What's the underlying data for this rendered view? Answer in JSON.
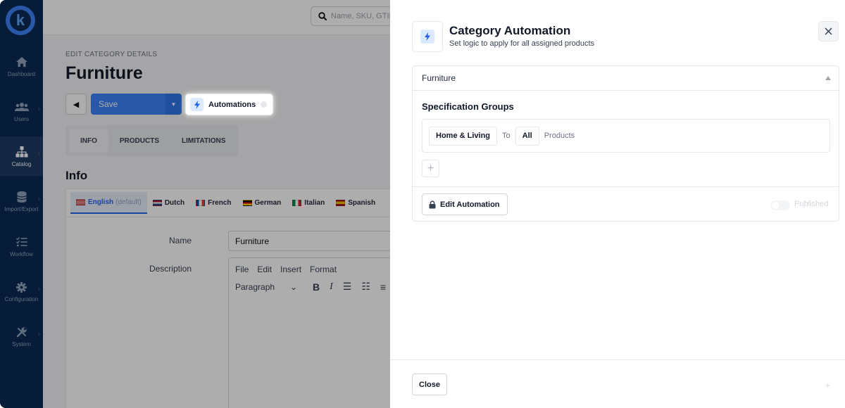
{
  "sidebar": {
    "logo_letter": "k",
    "items": [
      {
        "label": "Dashboard",
        "icon": "home-icon",
        "has_chevron": false
      },
      {
        "label": "Users",
        "icon": "users-icon",
        "has_chevron": true
      },
      {
        "label": "Catalog",
        "icon": "sitemap-icon",
        "has_chevron": true
      },
      {
        "label": "Import/Export",
        "icon": "database-icon",
        "has_chevron": true
      },
      {
        "label": "Workflow",
        "icon": "tasks-icon",
        "has_chevron": false
      },
      {
        "label": "Configuration",
        "icon": "gear-icon",
        "has_chevron": true
      },
      {
        "label": "System",
        "icon": "tools-icon",
        "has_chevron": true
      }
    ]
  },
  "topbar": {
    "search_placeholder": "Name, SKU, GTIN"
  },
  "page": {
    "eyebrow": "EDIT CATEGORY DETAILS",
    "title": "Furniture",
    "save_label": "Save",
    "automations_label": "Automations",
    "tabs": [
      "INFO",
      "PRODUCTS",
      "LIMITATIONS"
    ],
    "section_title": "Info",
    "languages": [
      {
        "label": "English",
        "note": "(default)"
      },
      {
        "label": "Dutch"
      },
      {
        "label": "French"
      },
      {
        "label": "German"
      },
      {
        "label": "Italian"
      },
      {
        "label": "Spanish"
      }
    ],
    "form": {
      "name_label": "Name",
      "name_value": "Furniture",
      "description_label": "Description",
      "editor_menu": [
        "File",
        "Edit",
        "Insert",
        "Format"
      ],
      "paragraph_label": "Paragraph"
    }
  },
  "drawer": {
    "title": "Category Automation",
    "subtitle": "Set logic to apply for all assigned products",
    "panel": {
      "header": "Furniture",
      "spec_title": "Specification Groups",
      "rule": {
        "group": "Home & Living",
        "to_word": "To",
        "scope": "All",
        "target": "Products"
      },
      "add_symbol": "+",
      "edit_label": "Edit Automation",
      "published_label": "Published",
      "published": false
    },
    "footer": {
      "close_label": "Close"
    }
  },
  "colors": {
    "sidebar": "#0b2a54",
    "primary": "#3b82f6",
    "accent_light": "#dbeafe"
  }
}
